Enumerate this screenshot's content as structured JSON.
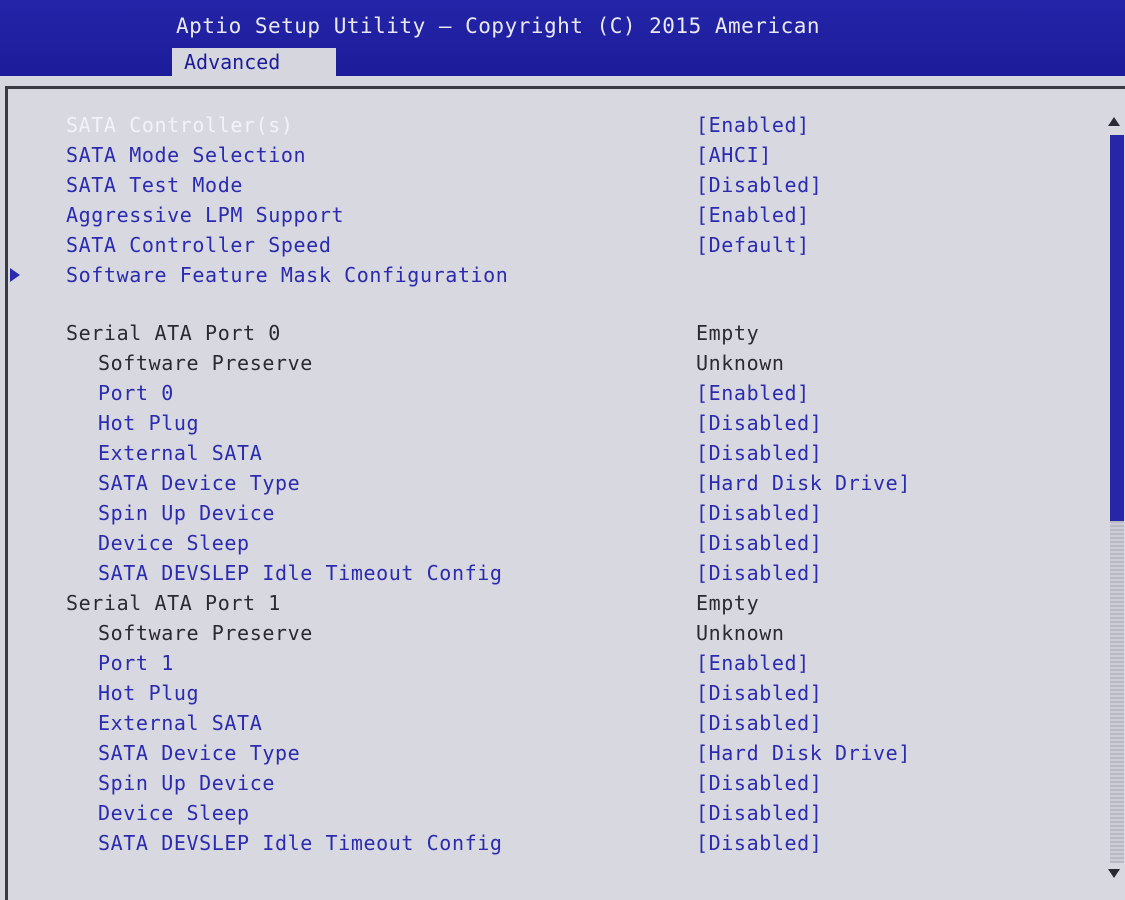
{
  "window": {
    "title": "Aptio Setup Utility – Copyright (C) 2015 American",
    "tabs": [
      {
        "label": "Advanced",
        "active": true
      }
    ]
  },
  "icons": {
    "submenu": "submenu-arrow-icon",
    "scroll_up": "scroll-up-arrow-icon",
    "scroll_down": "scroll-down-arrow-icon"
  },
  "colors": {
    "header_bg": "#1c1c9a",
    "selectable_text": "#2b2bb0",
    "selected_text": "#f2f2fa",
    "static_text": "#2a2a30",
    "panel_bg": "#d8d8e0"
  },
  "scrollbar": {
    "thumb_fraction": 0.53
  },
  "settings": [
    {
      "label": "SATA Controller(s)",
      "value": "[Enabled]",
      "selected": true
    },
    {
      "label": "SATA Mode Selection",
      "value": "[AHCI]"
    },
    {
      "label": "SATA Test Mode",
      "value": "[Disabled]"
    },
    {
      "label": "Aggressive LPM Support",
      "value": "[Enabled]"
    },
    {
      "label": "SATA Controller Speed",
      "value": "[Default]"
    },
    {
      "label": "Software Feature Mask Configuration",
      "value": "",
      "submenu": true
    },
    {
      "label": "Serial ATA Port 0",
      "value": "Empty",
      "static": true
    },
    {
      "label": "Software Preserve",
      "value": "Unknown",
      "static": true
    },
    {
      "label": "Port 0",
      "value": "[Enabled]"
    },
    {
      "label": "Hot Plug",
      "value": "[Disabled]"
    },
    {
      "label": "External SATA",
      "value": "[Disabled]"
    },
    {
      "label": "SATA Device Type",
      "value": "[Hard Disk Drive]"
    },
    {
      "label": "Spin Up Device",
      "value": "[Disabled]"
    },
    {
      "label": "Device Sleep",
      "value": "[Disabled]"
    },
    {
      "label": "SATA DEVSLEP Idle Timeout Config",
      "value": "[Disabled]"
    },
    {
      "label": "Serial ATA Port 1",
      "value": "Empty",
      "static": true
    },
    {
      "label": "Software Preserve",
      "value": "Unknown",
      "static": true
    },
    {
      "label": "Port 1",
      "value": "[Enabled]"
    },
    {
      "label": "Hot Plug",
      "value": "[Disabled]"
    },
    {
      "label": "External SATA",
      "value": "[Disabled]"
    },
    {
      "label": "SATA Device Type",
      "value": "[Hard Disk Drive]"
    },
    {
      "label": "Spin Up Device",
      "value": "[Disabled]"
    },
    {
      "label": "Device Sleep",
      "value": "[Disabled]"
    },
    {
      "label": "SATA DEVSLEP Idle Timeout Config",
      "value": "[Disabled]"
    }
  ]
}
